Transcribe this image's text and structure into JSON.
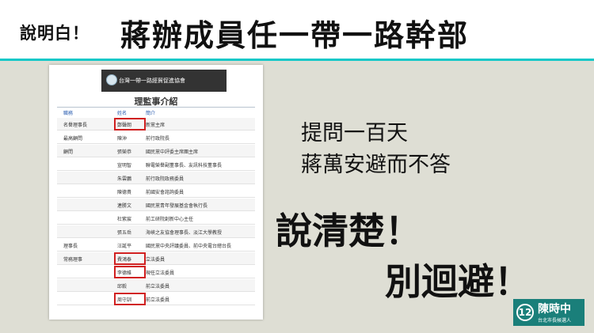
{
  "header": {
    "prefix": "說明白！",
    "title": "蔣辦成員任一帶一路幹部"
  },
  "screenshot": {
    "association_name": "台灣一帶一路經貿促進協會",
    "table_title": "理監事介紹",
    "columns": [
      "職務",
      "姓名",
      "簡介"
    ],
    "rows": [
      {
        "role": "名譽理事長",
        "name": "鄭聲朗",
        "intro": "新黨主席",
        "highlight": true
      },
      {
        "role": "最高顧問",
        "name": "陳沖",
        "intro": "前行政院長",
        "highlight": false
      },
      {
        "role": "顧問",
        "name": "張榮恭",
        "intro": "國民黨中評委主席團主席",
        "highlight": false
      },
      {
        "role": "",
        "name": "宣明智",
        "intro": "聯電榮譽副董事長、友訊科技董事長",
        "highlight": false
      },
      {
        "role": "",
        "name": "朱雲鵬",
        "intro": "前行政院政務委員",
        "highlight": false
      },
      {
        "role": "",
        "name": "陳德貴",
        "intro": "前國安會諮詢委員",
        "highlight": false
      },
      {
        "role": "",
        "name": "連勝文",
        "intro": "國民黨青年發展基金會執行長",
        "highlight": false
      },
      {
        "role": "",
        "name": "杜紫宸",
        "intro": "前工研院創新中心主任",
        "highlight": false
      },
      {
        "role": "",
        "name": "張五岳",
        "intro": "海峽之友協會理事長、淡江大學教授",
        "highlight": false
      },
      {
        "role": "理事長",
        "name": "汪誕平",
        "intro": "國民黨中央評議委員、前中央電台總台長",
        "highlight": false
      },
      {
        "role": "常務理事",
        "name": "費鴻泰",
        "intro": "立法委員",
        "highlight": true
      },
      {
        "role": "",
        "name": "李德維",
        "intro": "現任立法委員",
        "highlight": true
      },
      {
        "role": "",
        "name": "邱毅",
        "intro": "前立法委員",
        "highlight": false
      },
      {
        "role": "",
        "name": "周守訓",
        "intro": "前立法委員",
        "highlight": true
      }
    ]
  },
  "statement": {
    "line1": "提問一百天",
    "line2": "蔣萬安避而不答",
    "big1": "說清楚！",
    "big2": "別迴避！"
  },
  "badge": {
    "number": "12",
    "name": "陳時中",
    "subtitle": "台北市長候選人"
  },
  "colors": {
    "background": "#deded4",
    "header_accent": "#14c8c8",
    "highlight_box": "#d02020",
    "badge": "#1a7f7a"
  }
}
